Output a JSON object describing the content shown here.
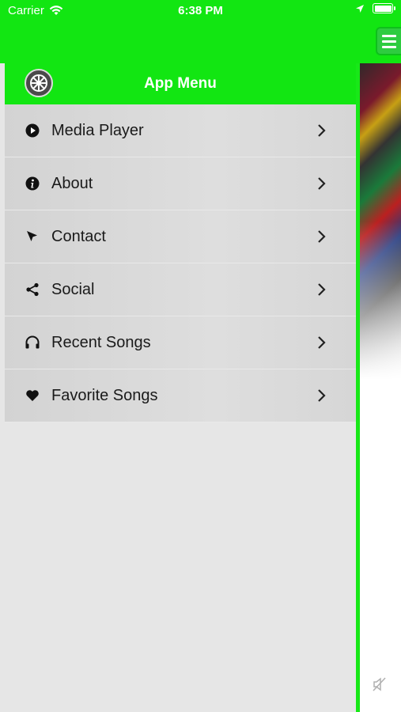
{
  "status_bar": {
    "carrier": "Carrier",
    "time": "6:38 PM"
  },
  "drawer": {
    "title": "App Menu",
    "items": [
      {
        "label": "Media Player",
        "icon": "play-circle-icon"
      },
      {
        "label": "About",
        "icon": "info-icon"
      },
      {
        "label": "Contact",
        "icon": "cursor-arrow-icon"
      },
      {
        "label": "Social",
        "icon": "share-icon"
      },
      {
        "label": "Recent Songs",
        "icon": "headphones-icon"
      },
      {
        "label": "Favorite Songs",
        "icon": "heart-icon"
      }
    ]
  },
  "colors": {
    "accent_green": "#12e612",
    "drawer_bg": "#e6e6e6",
    "text": "#1a1a1a"
  }
}
